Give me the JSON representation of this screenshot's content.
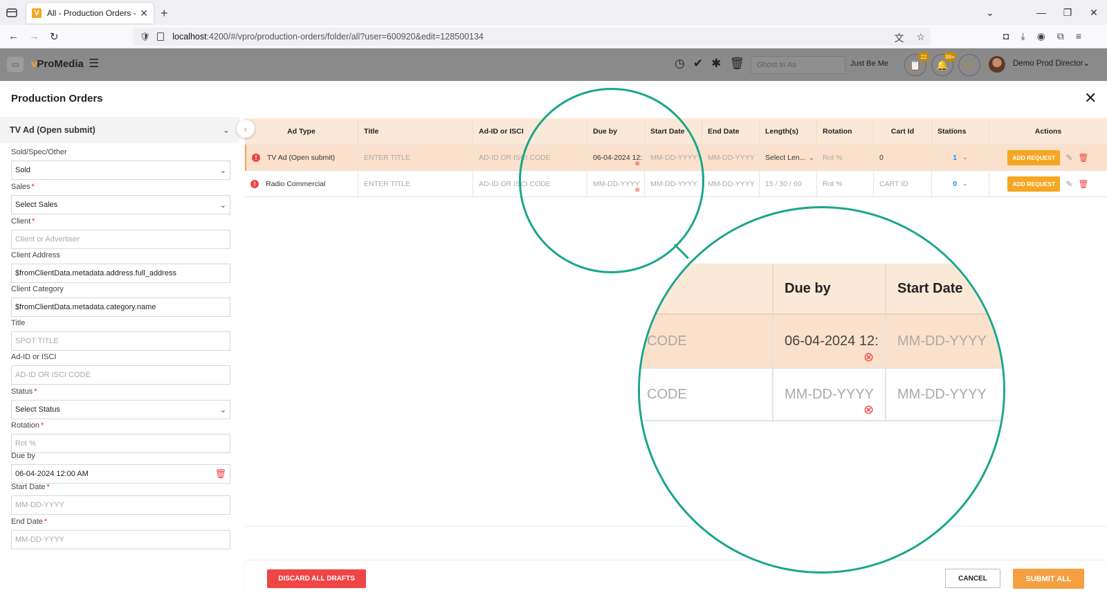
{
  "browser": {
    "tab_title": "All - Production Orders - vPro |",
    "favicon_letter": "V",
    "url_host": "localhost",
    "url_rest": ":4200/#/vpro/production-orders/folder/all?user=600920&edit=128500134"
  },
  "app": {
    "brand_prefix": "v",
    "brand_name": "ProMedia",
    "ghost_placeholder": "Ghost In As",
    "just_be_me": "Just Be Me",
    "orders_badge": "22",
    "notifications_badge": "99+",
    "user_name": "Demo Prod Director"
  },
  "panel": {
    "title": "Production Orders"
  },
  "sidebar": {
    "header": "TV Ad (Open submit)",
    "fields": {
      "sold_spec": {
        "label": "Sold/Spec/Other",
        "value": "Sold"
      },
      "sales": {
        "label": "Sales",
        "value": "Select Sales"
      },
      "client": {
        "label": "Client",
        "placeholder": "Client or Advertiser"
      },
      "client_address": {
        "label": "Client Address",
        "value": "$fromClientData.metadata.address.full_address"
      },
      "client_category": {
        "label": "Client Category",
        "value": "$fromClientData.metadata.category.name"
      },
      "title": {
        "label": "Title",
        "placeholder": "SPOT TITLE"
      },
      "ad_id": {
        "label": "Ad-ID or ISCI",
        "placeholder": "AD-ID OR ISCI CODE"
      },
      "status": {
        "label": "Status",
        "value": "Select Status"
      },
      "rotation": {
        "label": "Rotation",
        "placeholder": "Rot %"
      },
      "due_by": {
        "label": "Due by",
        "value": "06-04-2024 12:00 AM"
      },
      "start_date": {
        "label": "Start Date",
        "placeholder": "MM-DD-YYYY"
      },
      "end_date": {
        "label": "End Date",
        "placeholder": "MM-DD-YYYY"
      }
    }
  },
  "table": {
    "columns": [
      "Ad Type",
      "Title",
      "Ad-ID or ISCI",
      "Due by",
      "Start Date",
      "End Date",
      "Length(s)",
      "Rotation",
      "Cart Id",
      "Stations",
      "Actions"
    ],
    "rows": [
      {
        "ad_type": "TV Ad (Open submit)",
        "title": "ENTER TITLE",
        "ad_id": "AD-ID OR ISCI CODE",
        "due_by": "06-04-2024 12:",
        "start_date": "MM-DD-YYYY",
        "end_date": "MM-DD-YYYY",
        "length": "Select Len...",
        "rotation": "Rot %",
        "cart_id": "0",
        "stations": "1",
        "action": "ADD REQUEST"
      },
      {
        "ad_type": "Radio Commercial",
        "title": "ENTER TITLE",
        "ad_id": "AD-ID OR ISCI CODE",
        "due_by": "MM-DD-YYYY",
        "start_date": "MM-DD-YYYY",
        "end_date": "MM-DD-YYYY",
        "length": "15 / 30 / 60",
        "rotation": "Rot %",
        "cart_id": "CART ID",
        "stations": "0",
        "action": "ADD REQUEST"
      }
    ]
  },
  "footer": {
    "discard": "DISCARD ALL DRAFTS",
    "cancel": "CANCEL",
    "submit": "SUBMIT ALL"
  },
  "magnifier": {
    "col_due": "Due by",
    "col_start": "Start Date",
    "r1_code": "CODE",
    "r1_due": "06-04-2024 12:",
    "r1_start": "MM-DD-YYYY",
    "r2_code": "CODE",
    "r2_due": "MM-DD-YYYY",
    "r2_start": "MM-DD-YYYY"
  },
  "colors": {
    "accent": "#f5a623",
    "danger": "#ef4545",
    "annotation": "#1aa68a",
    "header_gray": "#8a8a8a"
  }
}
